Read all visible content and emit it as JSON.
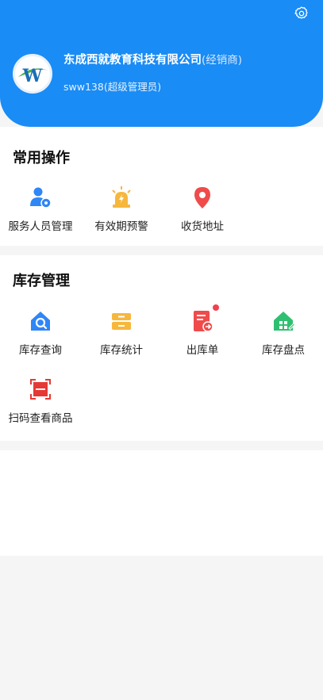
{
  "header": {
    "company_name": "东成西就教育科技有限公司",
    "company_role": "(经销商)",
    "user": "sww138(超级管理员)",
    "settings_icon": "gear-icon",
    "avatar_letter": "W"
  },
  "common_ops": {
    "title": "常用操作",
    "items": [
      {
        "label": "服务人员管理",
        "icon": "user-gear-icon"
      },
      {
        "label": "有效期预警",
        "icon": "alarm-light-icon"
      },
      {
        "label": "收货地址",
        "icon": "location-pin-icon"
      }
    ]
  },
  "inventory": {
    "title": "库存管理",
    "items": [
      {
        "label": "库存查询",
        "icon": "home-search-icon"
      },
      {
        "label": "库存统计",
        "icon": "drawer-icon"
      },
      {
        "label": "出库单",
        "icon": "document-out-icon",
        "badge": true
      },
      {
        "label": "库存盘点",
        "icon": "house-edit-icon"
      },
      {
        "label": "扫码查看商品",
        "icon": "scan-icon"
      }
    ]
  },
  "colors": {
    "header_blue": "#1a8cf5",
    "icon_blue": "#2f86f6",
    "icon_orange": "#f6b73c",
    "icon_red": "#ef4b4b",
    "icon_green": "#2fbf71",
    "badge_red": "#f0424f"
  }
}
